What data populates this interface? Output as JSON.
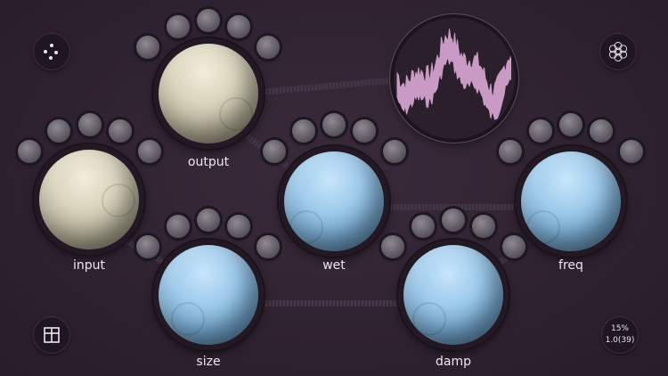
{
  "knobs": [
    {
      "id": "output",
      "label": "output",
      "color": "cream"
    },
    {
      "id": "input",
      "label": "input",
      "color": "cream"
    },
    {
      "id": "wet",
      "label": "wet",
      "color": "blue"
    },
    {
      "id": "freq",
      "label": "freq",
      "color": "blue"
    },
    {
      "id": "size",
      "label": "size",
      "color": "blue"
    },
    {
      "id": "damp",
      "label": "damp",
      "color": "blue"
    }
  ],
  "status": {
    "cpu_percent": "15%",
    "version": "1.0(39)"
  },
  "icons": {
    "top_left": "dice-icon",
    "top_right": "flower-pattern-icon",
    "bottom_left": "split-panel-icon",
    "waveform": "waveform-icon"
  },
  "colors": {
    "background": "#2f2230",
    "knob_cream": "#d8d4bd",
    "knob_blue": "#9fcbec",
    "waveform": "#c99bc4"
  }
}
